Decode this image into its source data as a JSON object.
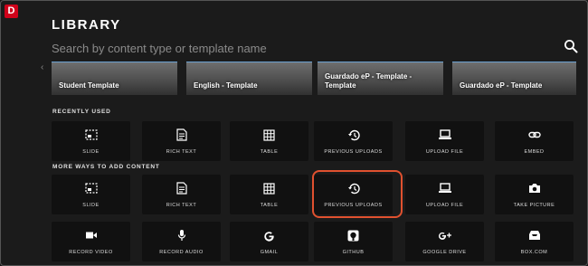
{
  "app": {
    "logo_letter": "D",
    "title": "LIBRARY"
  },
  "search": {
    "placeholder": "Search by content type or template name",
    "icon": "search-icon"
  },
  "templates": [
    {
      "label": "Student Template"
    },
    {
      "label": "English - Template"
    },
    {
      "label": "Guardado eP - Template - Template"
    },
    {
      "label": "Guardado eP - Template"
    }
  ],
  "sections": {
    "recent": "RECENTLY USED",
    "more": "MORE WAYS TO ADD CONTENT"
  },
  "recent_items": [
    {
      "label": "SLIDE",
      "icon": "slide-icon"
    },
    {
      "label": "RICH TEXT",
      "icon": "document-icon"
    },
    {
      "label": "TABLE",
      "icon": "table-icon"
    },
    {
      "label": "PREVIOUS UPLOADS",
      "icon": "history-icon"
    },
    {
      "label": "UPLOAD FILE",
      "icon": "laptop-icon"
    },
    {
      "label": "EMBED",
      "icon": "link-icon"
    }
  ],
  "more_items": [
    {
      "label": "SLIDE",
      "icon": "slide-icon"
    },
    {
      "label": "RICH TEXT",
      "icon": "document-icon"
    },
    {
      "label": "TABLE",
      "icon": "table-icon"
    },
    {
      "label": "PREVIOUS UPLOADS",
      "icon": "history-icon"
    },
    {
      "label": "UPLOAD FILE",
      "icon": "laptop-icon"
    },
    {
      "label": "TAKE PICTURE",
      "icon": "camera-icon"
    },
    {
      "label": "RECORD VIDEO",
      "icon": "video-camera-icon"
    },
    {
      "label": "RECORD AUDIO",
      "icon": "microphone-icon"
    },
    {
      "label": "GMAIL",
      "icon": "google-icon"
    },
    {
      "label": "GITHUB",
      "icon": "github-icon"
    },
    {
      "label": "GOOGLE DRIVE",
      "icon": "google-plus-icon"
    },
    {
      "label": "BOX.COM",
      "icon": "box-icon"
    }
  ],
  "colors": {
    "accent_highlight": "#e0512f",
    "logo": "#d0021b",
    "background": "#1b1b1b",
    "tile": "#111111"
  }
}
